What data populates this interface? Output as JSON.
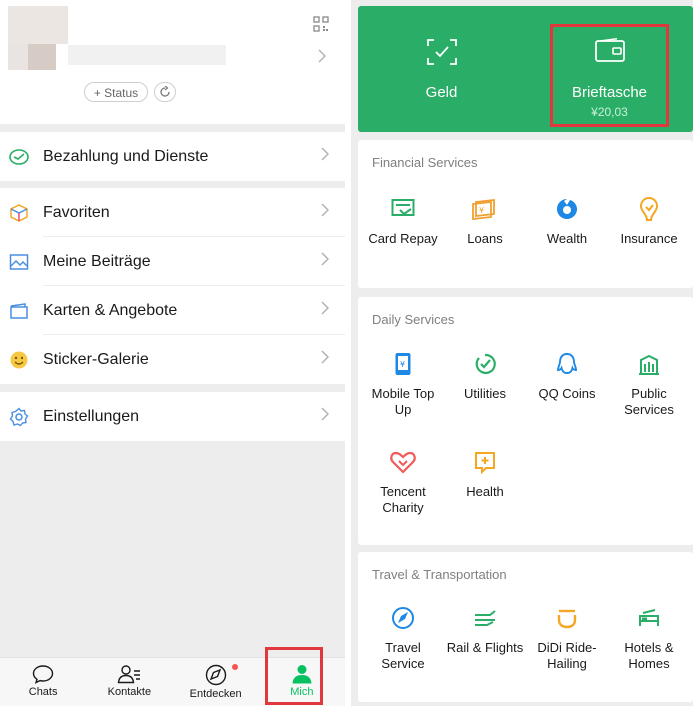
{
  "profile": {
    "status_label": "+ Status"
  },
  "menu": {
    "pay": "Bezahlung und Dienste",
    "favorites": "Favoriten",
    "posts": "Meine Beiträge",
    "cards": "Karten & Angebote",
    "stickers": "Sticker-Galerie",
    "settings": "Einstellungen"
  },
  "tabbar": {
    "chats": "Chats",
    "contacts": "Kontakte",
    "discover": "Entdecken",
    "me": "Mich",
    "active": "Mich"
  },
  "wallet": {
    "money_label": "Geld",
    "wallet_label": "Brieftasche",
    "wallet_balance": "¥20,03"
  },
  "financial": {
    "title": "Financial Services",
    "items": [
      "Card Repay",
      "Loans",
      "Wealth",
      "Insurance"
    ]
  },
  "daily": {
    "title": "Daily Services",
    "items": [
      "Mobile Top Up",
      "Utilities",
      "QQ Coins",
      "Public Services",
      "Tencent Charity",
      "Health"
    ]
  },
  "travel": {
    "title": "Travel & Transportation",
    "items": [
      "Travel Service",
      "Rail & Flights",
      "DiDi Ride-Hailing",
      "Hotels & Homes"
    ]
  },
  "colors": {
    "brand_green": "#2aae67",
    "active_tab": "#07c160",
    "highlight_box": "#e0383d"
  }
}
